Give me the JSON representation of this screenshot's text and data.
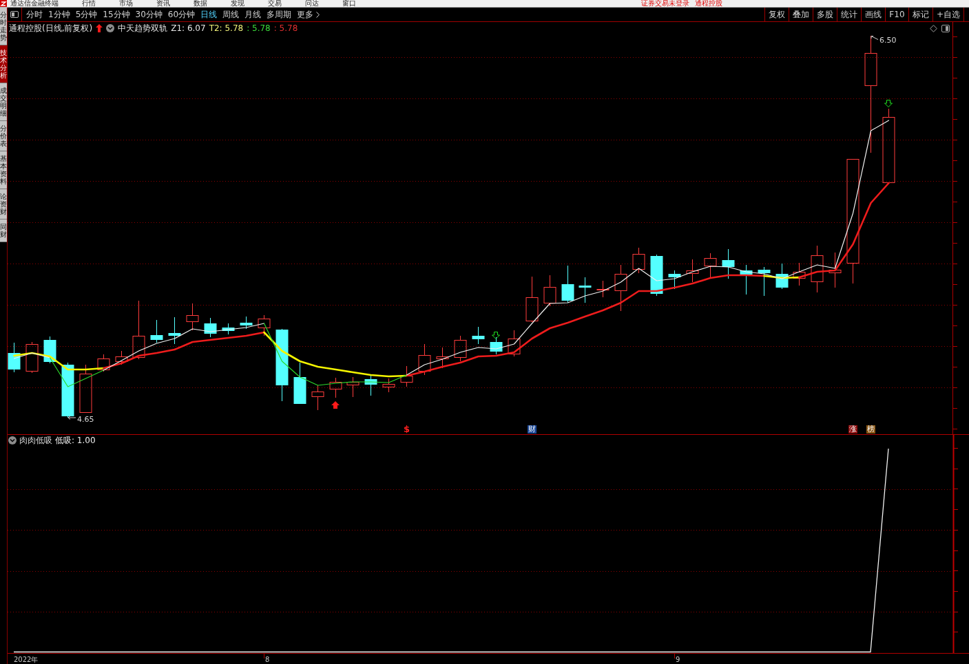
{
  "menu_bar": {
    "app_title": "通达信金融终端",
    "items": [
      "行情",
      "市场",
      "资讯",
      "数据",
      "发现",
      "交易",
      "问达",
      "窗口"
    ],
    "notices": [
      "证券交易未登录",
      "通程控股"
    ]
  },
  "period_bar": {
    "periods": [
      {
        "label": "分时",
        "selected": false
      },
      {
        "label": "1分钟",
        "selected": false
      },
      {
        "label": "5分钟",
        "selected": false
      },
      {
        "label": "15分钟",
        "selected": false
      },
      {
        "label": "30分钟",
        "selected": false
      },
      {
        "label": "60分钟",
        "selected": false
      },
      {
        "label": "日线",
        "selected": true
      },
      {
        "label": "周线",
        "selected": false
      },
      {
        "label": "月线",
        "selected": false
      },
      {
        "label": "多周期",
        "selected": false
      }
    ],
    "more": "更多",
    "tools": [
      "复权",
      "叠加",
      "多股",
      "统计",
      "画线",
      "F10",
      "标记",
      "+自选"
    ]
  },
  "side_tabs": [
    {
      "label": "分时走势",
      "selected": false
    },
    {
      "label": "技术分析",
      "selected": true
    },
    {
      "label": "成交明细",
      "selected": false
    },
    {
      "label": "分价表",
      "selected": false
    },
    {
      "label": "基本资料",
      "selected": false
    },
    {
      "label": "论资财",
      "selected": false
    },
    {
      "label": "同财",
      "selected": false
    }
  ],
  "price_panel": {
    "title": "通程控股(日线,前复权)",
    "indicator": "中天趋势双轨",
    "readings": [
      {
        "text": "Z1: 6.07",
        "color": "#e6e6e6"
      },
      {
        "text": "T2: 5.78",
        "color": "#f0f07a"
      },
      {
        "text": ": 5.78",
        "color": "#3cdc3c"
      },
      {
        "text": ": 5.78",
        "color": "#e23030"
      }
    ],
    "high_label": "6.50",
    "low_label": "4.65",
    "event_marks": [
      {
        "text": "$",
        "kind": "symbol",
        "color": "#ff2020"
      },
      {
        "text": "财",
        "kind": "tag",
        "color": "#1e4b9a"
      },
      {
        "text": "涨",
        "kind": "tag",
        "color": "#8c0a0a"
      },
      {
        "text": "榜",
        "kind": "tag",
        "color": "#8a5512"
      }
    ]
  },
  "indicator_panel": {
    "title": "肉肉低吸",
    "reading": "低吸: 1.00"
  },
  "date_axis": [
    "2022年",
    "8",
    "9"
  ]
}
